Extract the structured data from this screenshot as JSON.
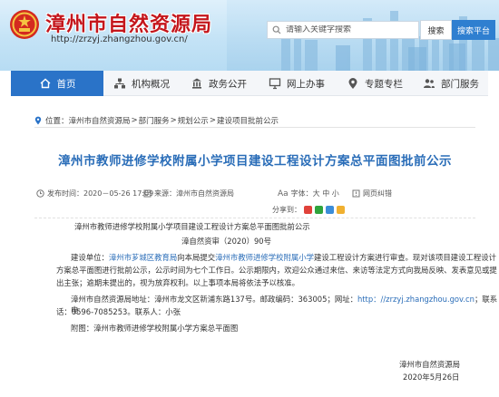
{
  "header": {
    "site_title": "漳州市自然资源局",
    "site_url": "http://zrzyj.zhangzhou.gov.cn/",
    "search_placeholder": "请输入关键字搜索",
    "search_button": "搜索",
    "platform_button": "搜索平台"
  },
  "nav": {
    "items": [
      {
        "label": "首页",
        "icon": "home-icon"
      },
      {
        "label": "机构概况",
        "icon": "org-chart-icon"
      },
      {
        "label": "政务公开",
        "icon": "gov-open-icon"
      },
      {
        "label": "网上办事",
        "icon": "monitor-icon"
      },
      {
        "label": "专题专栏",
        "icon": "pin-icon"
      },
      {
        "label": "部门服务",
        "icon": "people-icon"
      }
    ],
    "active_index": 0
  },
  "breadcrumb": {
    "prefix": "位置：",
    "items": [
      "漳州市自然资源局",
      "部门服务",
      "规划公示",
      "建设项目批前公示"
    ],
    "separator": ">"
  },
  "article": {
    "title": "漳州市教师进修学校附属小学项目建设工程设计方案总平面图批前公示",
    "meta": {
      "date_label": "发布时间：",
      "date": "2020－05-26 17:09",
      "source_label": "来源：",
      "source": "漳州市自然资源局",
      "font_size_label": "字体：",
      "font_sizes": "大 中 小",
      "error_report": "网页纠错",
      "share_label": "分享到："
    },
    "heading": "漳州市教师进修学校附属小学项目建设工程设计方案总平面图批前公示",
    "doc_number": "漳自然资审（2020）90号",
    "para1_prefix": "建设单位：",
    "para1_unit": "漳州市芗城区教育局",
    "para1_mid": "向本局提交",
    "para1_project": "漳州市教师进修学校附属小学",
    "para1_rest1": "建设工程设计方案进行审查。现对该项目建设工程设计",
    "para1_rest2": "方案总平面图进行批前公示，公示时间为七个工作日。公示期限内，欢迎公众通过来信、来访等法定方式向我局反映、发表意见或提",
    "para1_rest3": "出主张；逾期未提出的，视为放弃权利。以上事项本局将依法予以核准。",
    "para2_line1": "漳州市自然资源局地址：漳州市龙文区新浦东路137号。邮政编码：363005；网址：",
    "para2_url": "http：//zrzyj.zhangzhou.gov.cn",
    "para2_tail": "；联系电",
    "para2_line2": "话：0596-7085253。联系人：小张",
    "attachment": "附图：漳州市教师进修学校附属小学方案总平面图",
    "signature": "漳州市自然资源局",
    "sign_date": "2020年5月26日"
  },
  "colors": {
    "nav_active": "#2a73c8",
    "title_red": "#c4161c",
    "link_blue": "#2a6db8"
  }
}
